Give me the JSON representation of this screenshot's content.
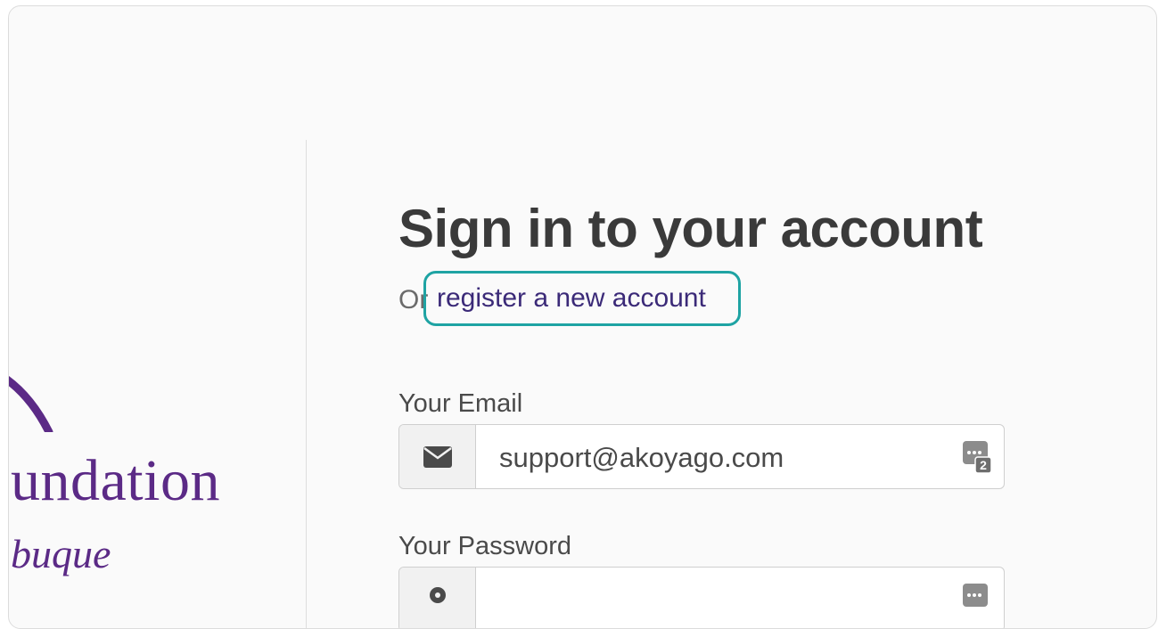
{
  "brand": {
    "line1": "undation",
    "line2": "buque",
    "color": "#5b2a86"
  },
  "form": {
    "title": "Sign in to your account",
    "subtitle_prefix": "Or",
    "register_link": "register a new account",
    "email": {
      "label": "Your Email",
      "value": "support@akoyago.com",
      "icon": "envelope-icon"
    },
    "password": {
      "label": "Your Password",
      "value": "",
      "icon": "key-icon"
    },
    "password_manager_icon": "password-manager-icon",
    "password_manager_badge": "2"
  },
  "colors": {
    "highlight": "#1ea3a3",
    "link": "#3b2a78",
    "title": "#3a3a3a"
  }
}
